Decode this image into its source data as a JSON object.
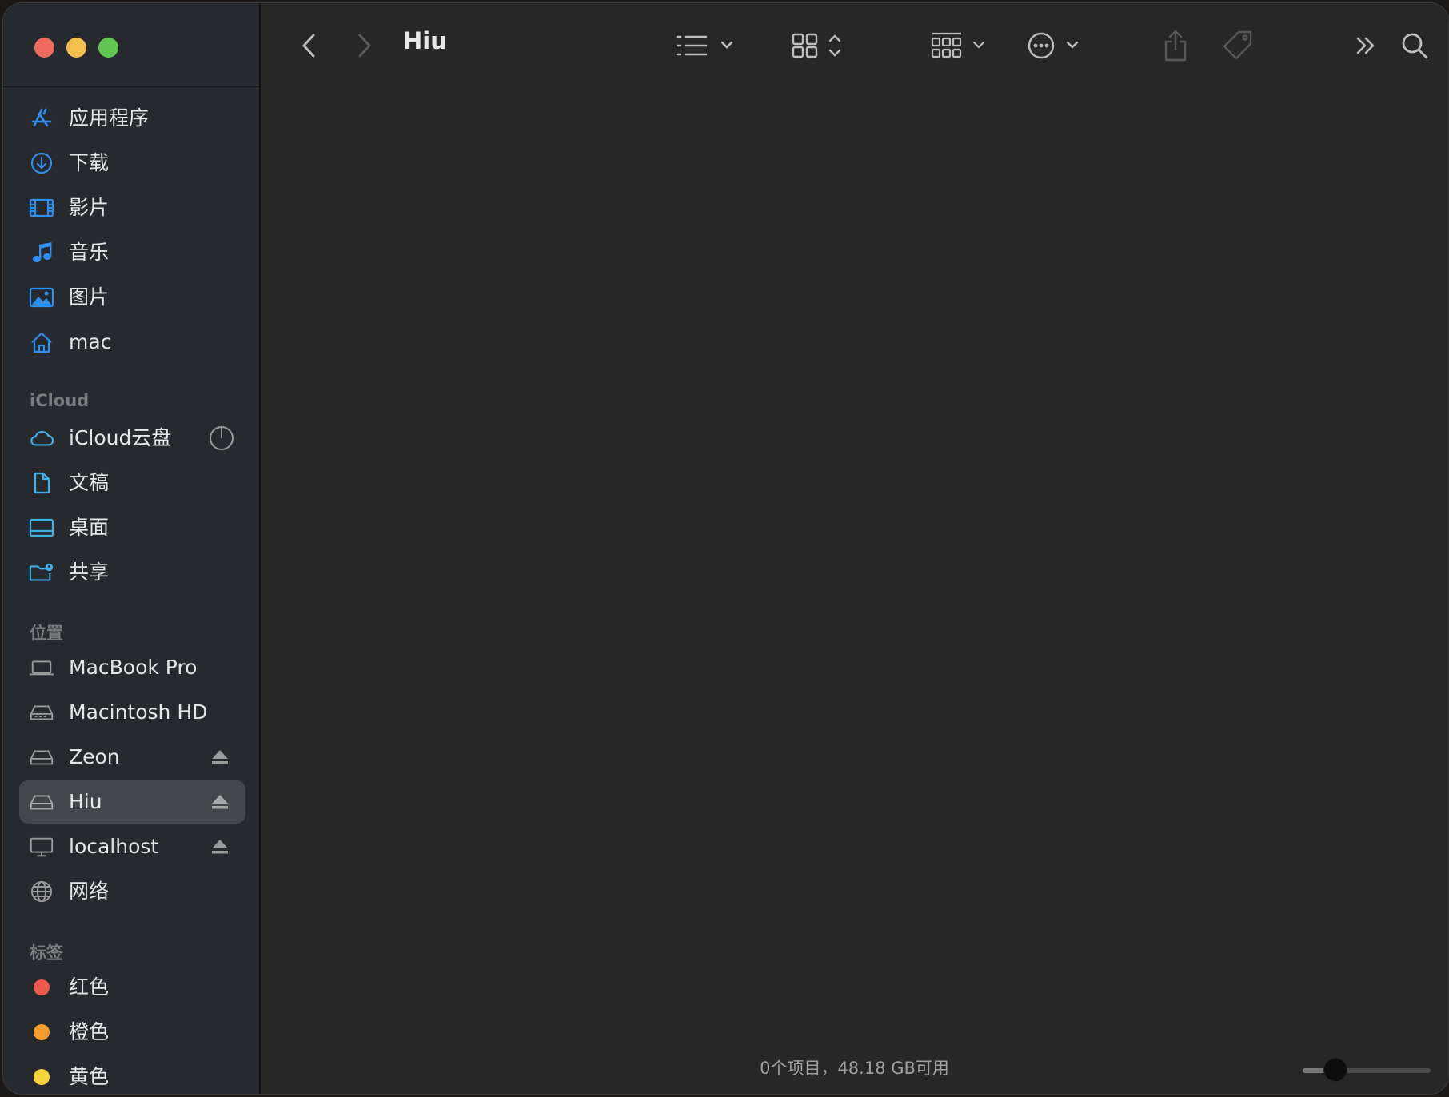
{
  "window": {
    "title": "Hiu",
    "status_text": "0个项目，48.18 GB可用",
    "icon_size_level": 0.2
  },
  "colors": {
    "accent": "#2f8ff0",
    "sidebar_bg": "#26292d",
    "content_bg": "#272727",
    "selection": "#43474c"
  },
  "sidebar": {
    "favorites": [
      {
        "label": "应用程序",
        "icon": "applications-icon"
      },
      {
        "label": "下载",
        "icon": "downloads-icon"
      },
      {
        "label": "影片",
        "icon": "movies-icon"
      },
      {
        "label": "音乐",
        "icon": "music-icon"
      },
      {
        "label": "图片",
        "icon": "pictures-icon"
      },
      {
        "label": "mac",
        "icon": "home-icon"
      }
    ],
    "icloud_title": "iCloud",
    "icloud": [
      {
        "label": "iCloud云盘",
        "icon": "cloud-icon"
      },
      {
        "label": "文稿",
        "icon": "document-icon"
      },
      {
        "label": "桌面",
        "icon": "desktop-icon"
      },
      {
        "label": "共享",
        "icon": "shared-folder-icon"
      }
    ],
    "locations_title": "位置",
    "locations": [
      {
        "label": "MacBook Pro",
        "icon": "laptop-icon"
      },
      {
        "label": "Macintosh HD",
        "icon": "internal-drive-icon"
      },
      {
        "label": "Zeon",
        "icon": "external-drive-icon"
      },
      {
        "label": "Hiu",
        "icon": "external-drive-icon"
      },
      {
        "label": "localhost",
        "icon": "display-icon"
      },
      {
        "label": "网络",
        "icon": "network-icon"
      }
    ],
    "tags_title": "标签",
    "tags": [
      {
        "label": "红色",
        "color": "#ef5a4f"
      },
      {
        "label": "橙色",
        "color": "#f59d2c"
      },
      {
        "label": "黄色",
        "color": "#f6d43a"
      }
    ]
  }
}
